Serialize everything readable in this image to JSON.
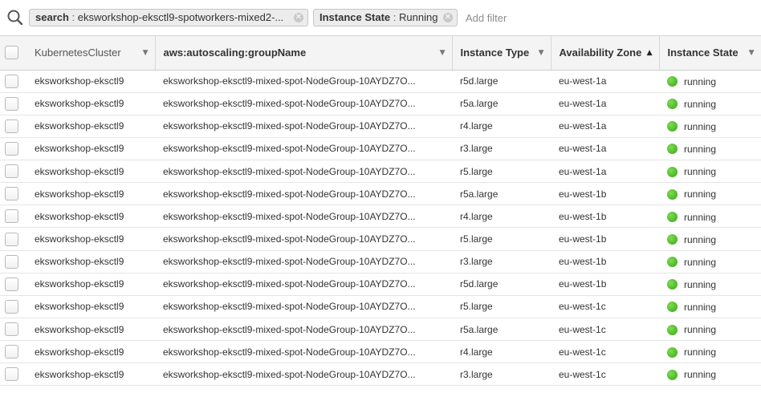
{
  "filter_bar": {
    "tokens": [
      {
        "key": "search",
        "separator": " : ",
        "value": "eksworkshop-eksctl9-spotworkers-mixed2-..."
      },
      {
        "key": "Instance State",
        "separator": " : ",
        "value": "Running"
      }
    ],
    "add_filter_placeholder": "Add filter"
  },
  "table": {
    "columns": [
      {
        "label": "KubernetesCluster",
        "sort": "▼"
      },
      {
        "label": "aws:autoscaling:groupName",
        "sort": "▼"
      },
      {
        "label": "Instance Type",
        "sort": "▼"
      },
      {
        "label": "Availability Zone",
        "sort": "▲"
      },
      {
        "label": "Instance State",
        "sort": "▼"
      }
    ],
    "rows": [
      {
        "cluster": "eksworkshop-eksctl9",
        "group": "eksworkshop-eksctl9-mixed-spot-NodeGroup-10AYDZ7O...",
        "type": "r5d.large",
        "zone": "eu-west-1a",
        "state": "running"
      },
      {
        "cluster": "eksworkshop-eksctl9",
        "group": "eksworkshop-eksctl9-mixed-spot-NodeGroup-10AYDZ7O...",
        "type": "r5a.large",
        "zone": "eu-west-1a",
        "state": "running"
      },
      {
        "cluster": "eksworkshop-eksctl9",
        "group": "eksworkshop-eksctl9-mixed-spot-NodeGroup-10AYDZ7O...",
        "type": "r4.large",
        "zone": "eu-west-1a",
        "state": "running"
      },
      {
        "cluster": "eksworkshop-eksctl9",
        "group": "eksworkshop-eksctl9-mixed-spot-NodeGroup-10AYDZ7O...",
        "type": "r3.large",
        "zone": "eu-west-1a",
        "state": "running"
      },
      {
        "cluster": "eksworkshop-eksctl9",
        "group": "eksworkshop-eksctl9-mixed-spot-NodeGroup-10AYDZ7O...",
        "type": "r5.large",
        "zone": "eu-west-1a",
        "state": "running"
      },
      {
        "cluster": "eksworkshop-eksctl9",
        "group": "eksworkshop-eksctl9-mixed-spot-NodeGroup-10AYDZ7O...",
        "type": "r5a.large",
        "zone": "eu-west-1b",
        "state": "running"
      },
      {
        "cluster": "eksworkshop-eksctl9",
        "group": "eksworkshop-eksctl9-mixed-spot-NodeGroup-10AYDZ7O...",
        "type": "r4.large",
        "zone": "eu-west-1b",
        "state": "running"
      },
      {
        "cluster": "eksworkshop-eksctl9",
        "group": "eksworkshop-eksctl9-mixed-spot-NodeGroup-10AYDZ7O...",
        "type": "r5.large",
        "zone": "eu-west-1b",
        "state": "running"
      },
      {
        "cluster": "eksworkshop-eksctl9",
        "group": "eksworkshop-eksctl9-mixed-spot-NodeGroup-10AYDZ7O...",
        "type": "r3.large",
        "zone": "eu-west-1b",
        "state": "running"
      },
      {
        "cluster": "eksworkshop-eksctl9",
        "group": "eksworkshop-eksctl9-mixed-spot-NodeGroup-10AYDZ7O...",
        "type": "r5d.large",
        "zone": "eu-west-1b",
        "state": "running"
      },
      {
        "cluster": "eksworkshop-eksctl9",
        "group": "eksworkshop-eksctl9-mixed-spot-NodeGroup-10AYDZ7O...",
        "type": "r5.large",
        "zone": "eu-west-1c",
        "state": "running"
      },
      {
        "cluster": "eksworkshop-eksctl9",
        "group": "eksworkshop-eksctl9-mixed-spot-NodeGroup-10AYDZ7O...",
        "type": "r5a.large",
        "zone": "eu-west-1c",
        "state": "running"
      },
      {
        "cluster": "eksworkshop-eksctl9",
        "group": "eksworkshop-eksctl9-mixed-spot-NodeGroup-10AYDZ7O...",
        "type": "r4.large",
        "zone": "eu-west-1c",
        "state": "running"
      },
      {
        "cluster": "eksworkshop-eksctl9",
        "group": "eksworkshop-eksctl9-mixed-spot-NodeGroup-10AYDZ7O...",
        "type": "r3.large",
        "zone": "eu-west-1c",
        "state": "running"
      }
    ]
  },
  "icons": {
    "search": "search-icon",
    "token_close": "close-circle-icon",
    "running_status": "green-dot-icon"
  },
  "colors": {
    "running": "#3aa51a",
    "token_bg": "#ececec",
    "header_bg": "#f4f4f4"
  }
}
